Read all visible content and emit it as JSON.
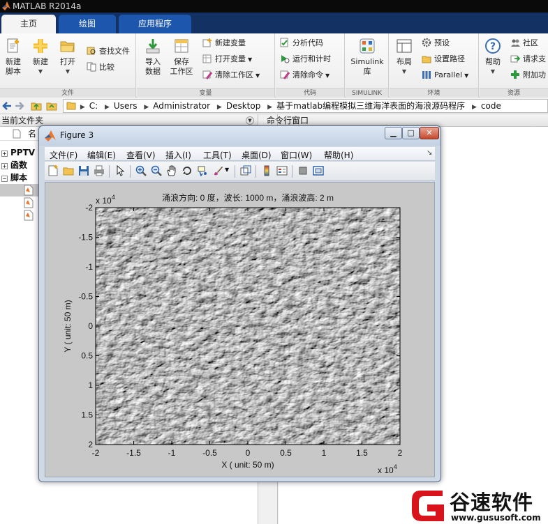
{
  "app": {
    "title": "MATLAB R2014a"
  },
  "tabs": [
    {
      "label": "主页",
      "active": true
    },
    {
      "label": "绘图",
      "active": false
    },
    {
      "label": "应用程序",
      "active": false
    }
  ],
  "ribbon": {
    "file": {
      "label": "文件",
      "new_script": "新建\n脚本",
      "new": "新建",
      "open": "打开",
      "find_files": "查找文件",
      "compare": "比较"
    },
    "variable": {
      "label": "变量",
      "import_data": "导入\n数据",
      "save_workspace": "保存\n工作区",
      "new_variable": "新建变量",
      "open_variable": "打开变量",
      "clear_workspace": "清除工作区"
    },
    "code": {
      "label": "代码",
      "analyze_code": "分析代码",
      "run_and_time": "运行和计时",
      "clear_commands": "清除命令"
    },
    "simulink": {
      "label": "SIMULINK",
      "button": "Simulink\n库"
    },
    "environment": {
      "label": "环境",
      "layout": "布局",
      "preferences": "预设",
      "set_path": "设置路径",
      "parallel": "Parallel"
    },
    "resources": {
      "label": "资源",
      "help": "帮助",
      "community": "社区",
      "request_support": "请求支",
      "add_ons": "附加功"
    }
  },
  "address": {
    "segments": [
      "C:",
      "Users",
      "Administrator",
      "Desktop",
      "基于matlab编程模拟三维海洋表面的海浪源码程序",
      "code"
    ]
  },
  "left_panel": {
    "title": "当前文件夹",
    "column_name": "名",
    "tree": [
      {
        "label": "PPTV",
        "expander": "+"
      },
      {
        "label": "函数",
        "expander": "+"
      },
      {
        "label": "脚本",
        "expander": "−"
      }
    ]
  },
  "right_panel": {
    "title": "命令行窗口"
  },
  "figure": {
    "window_title": "Figure 3",
    "menus": [
      "文件(F)",
      "编辑(E)",
      "查看(V)",
      "插入(I)",
      "工具(T)",
      "桌面(D)",
      "窗口(W)",
      "帮助(H)"
    ],
    "plot": {
      "title": "涌浪方向: 0 度，波长: 1000 m，涌浪波高: 2 m",
      "xlabel": "X ( unit: 50 m)",
      "ylabel": "Y ( unit: 50 m)",
      "x_exponent": "x 10",
      "x_exponent_power": "4",
      "y_exponent": "x 10",
      "y_exponent_power": "4",
      "xticks": [
        "-2",
        "-1.5",
        "-1",
        "-0.5",
        "0",
        "0.5",
        "1",
        "1.5",
        "2"
      ],
      "yticks": [
        "-2",
        "-1.5",
        "-1",
        "-0.5",
        "0",
        "0.5",
        "1",
        "1.5",
        "2"
      ]
    }
  },
  "watermark": {
    "text": "谷速软件",
    "url": "www.gususoft.com"
  },
  "colors": {
    "tabbar": "#133263",
    "tab": "#1c57ad",
    "watermark_red": "#d8131b"
  }
}
